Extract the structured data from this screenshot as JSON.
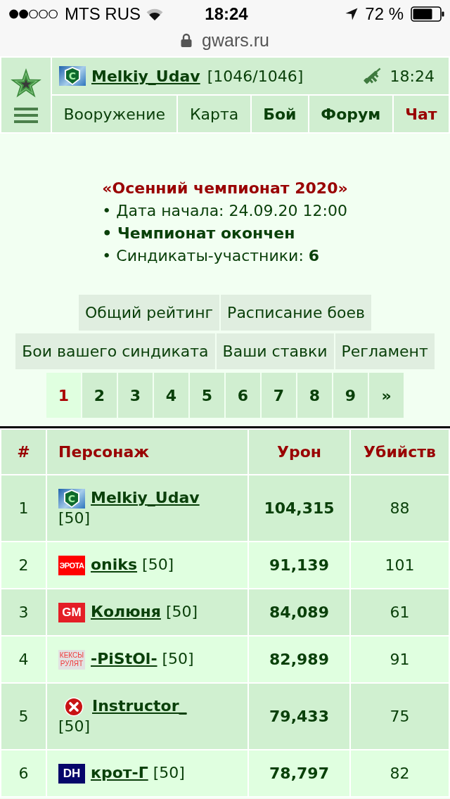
{
  "status_bar": {
    "carrier": "MTS RUS",
    "time": "18:24",
    "battery": "72 %"
  },
  "address_bar": {
    "url": "gwars.ru"
  },
  "header": {
    "player": {
      "badge": {
        "kind": "shield",
        "text": "C"
      },
      "name": "Melkiy_Udav",
      "health": "[1046/1046]"
    },
    "clock": "18:24",
    "nav": [
      {
        "label": "Вооружение",
        "kind": "plain"
      },
      {
        "label": "Карта",
        "kind": "plain"
      },
      {
        "label": "Бой",
        "kind": "bold"
      },
      {
        "label": "Форум",
        "kind": "bold"
      },
      {
        "label": "Чат",
        "kind": "alert"
      }
    ]
  },
  "championship": {
    "title": "«Осенний чемпионат 2020»",
    "items": [
      {
        "text": "• Дата начала: 24.09.20 12:00",
        "bold": false
      },
      {
        "text": "• Чемпионат окончен",
        "bold": true
      },
      {
        "text": "• Синдикаты-участники:",
        "value": "6",
        "bold": false
      }
    ]
  },
  "section_rows": [
    {
      "buttons": [
        {
          "label": "Общий рейтинг"
        },
        {
          "label": "Расписание боев"
        }
      ]
    },
    {
      "buttons": [
        {
          "label": "Бои вашего синдиката"
        },
        {
          "label": "Ваши ставки"
        },
        {
          "label": "Регламент"
        }
      ]
    }
  ],
  "pager": [
    {
      "label": "1",
      "selected": true
    },
    {
      "label": "2",
      "selected": false
    },
    {
      "label": "3",
      "selected": false
    },
    {
      "label": "4",
      "selected": false
    },
    {
      "label": "5",
      "selected": false
    },
    {
      "label": "6",
      "selected": false
    },
    {
      "label": "7",
      "selected": false
    },
    {
      "label": "8",
      "selected": false
    },
    {
      "label": "9",
      "selected": false
    },
    {
      "label": "»",
      "selected": false
    }
  ],
  "table": {
    "columns": [
      "#",
      "Персонаж",
      "Урон",
      "Убийств"
    ],
    "rows": [
      {
        "rank": "1",
        "badge": {
          "kind": "shield",
          "text": "C"
        },
        "name": "Melkiy_Udav",
        "tier": "[50]",
        "damage": "104,315",
        "kills": "88"
      },
      {
        "rank": "2",
        "badge": {
          "kind": "block",
          "text": "ЭРОТА",
          "color": "#ff0000"
        },
        "name": "oniks",
        "tier": "[50]",
        "damage": "91,139",
        "kills": "101"
      },
      {
        "rank": "3",
        "badge": {
          "kind": "block",
          "text": "GM",
          "color": "#e41e26"
        },
        "name": "Колюня",
        "tier": "[50]",
        "damage": "84,089",
        "kills": "61"
      },
      {
        "rank": "4",
        "badge": {
          "kind": "label",
          "text": "КЕКСЫ РУЛЯТ",
          "color": "#f03a3a"
        },
        "name": "-PiStOl-",
        "tier": "[50]",
        "damage": "82,989",
        "kills": "91"
      },
      {
        "rank": "5",
        "badge": {
          "kind": "cross"
        },
        "name": "Instructor_",
        "tier": "[50]",
        "damage": "79,433",
        "kills": "75"
      },
      {
        "rank": "6",
        "badge": {
          "kind": "block",
          "text": "DH",
          "color": "#06066a"
        },
        "name": "крот-Г",
        "tier": "[50]",
        "damage": "78,797",
        "kills": "82"
      }
    ]
  }
}
